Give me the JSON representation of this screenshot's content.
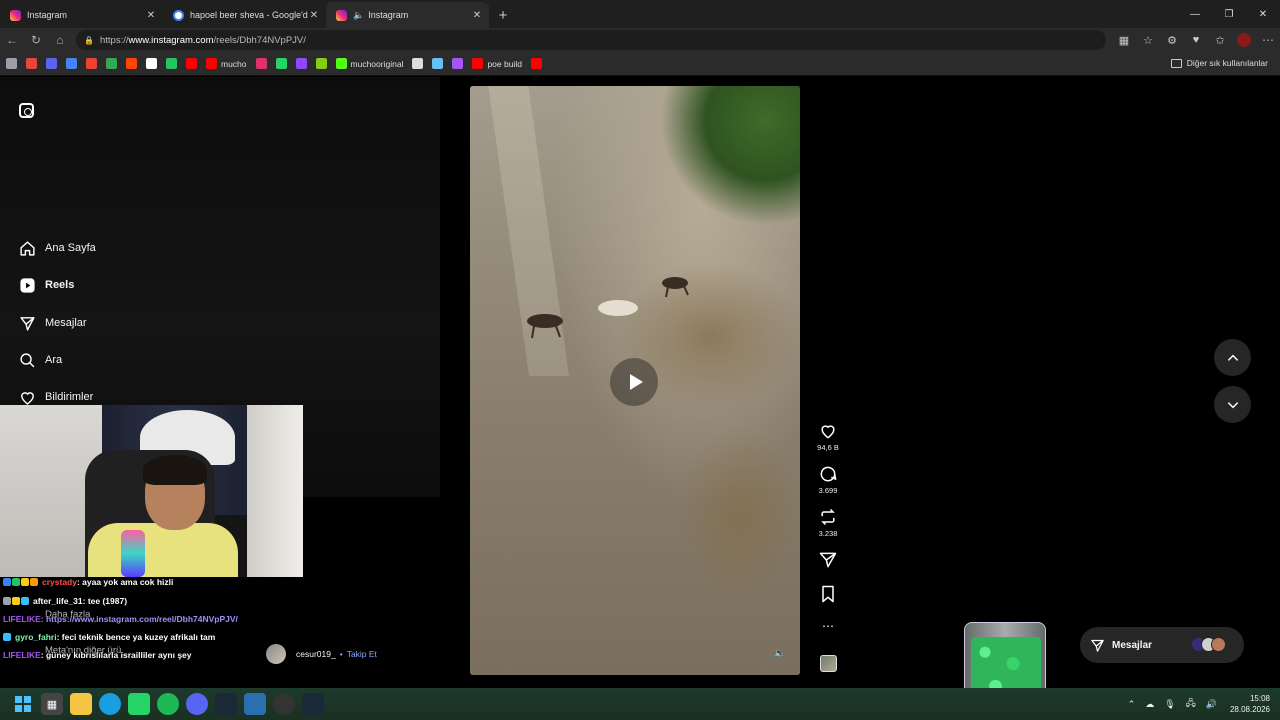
{
  "browser": {
    "tabs": [
      {
        "title": "Instagram",
        "favicon": "instagram-icon"
      },
      {
        "title": "hapoel beer sheva - Google'da Ara",
        "favicon": "google-icon"
      },
      {
        "title": "Instagram",
        "favicon": "instagram-icon",
        "active": true,
        "audio": true
      }
    ],
    "url": {
      "prefix": "https://",
      "host": "www.instagram.com",
      "path": "/reels/Dbh74NVpPJV/"
    },
    "bookmarks": [
      {
        "label": "",
        "icon": "link-icon",
        "color": "#9aa0a6"
      },
      {
        "label": "",
        "icon": "image-icon",
        "color": "#e8453c"
      },
      {
        "label": "",
        "icon": "discord-icon",
        "color": "#5865f2"
      },
      {
        "label": "",
        "icon": "docs-icon",
        "color": "#4285f4"
      },
      {
        "label": "",
        "icon": "gmail-icon",
        "color": "#ea4335"
      },
      {
        "label": "",
        "icon": "google-icon",
        "color": "#34a853"
      },
      {
        "label": "",
        "icon": "reddit-icon",
        "color": "#ff4500"
      },
      {
        "label": "",
        "icon": "x-icon",
        "color": "#ffffff"
      },
      {
        "label": "",
        "icon": "bar-icon",
        "color": "#22c55e"
      },
      {
        "label": "",
        "icon": "youtube-icon",
        "color": "#ff0000"
      },
      {
        "label": "mucho",
        "icon": "youtube-icon",
        "color": "#ff0000"
      },
      {
        "label": "",
        "icon": "instagram-icon",
        "color": "#e1306c"
      },
      {
        "label": "",
        "icon": "whatsapp-icon",
        "color": "#25d366"
      },
      {
        "label": "",
        "icon": "twitch-icon",
        "color": "#9146ff"
      },
      {
        "label": "",
        "icon": "star-icon",
        "color": "#84cc16"
      },
      {
        "label": "muchooriginal",
        "icon": "kick-icon",
        "color": "#53fc18"
      },
      {
        "label": "",
        "icon": "openai-icon",
        "color": "#dddddd"
      },
      {
        "label": "",
        "icon": "steam-icon",
        "color": "#66c0f4"
      },
      {
        "label": "",
        "icon": "pen-icon",
        "color": "#a855f7"
      },
      {
        "label": "poe build",
        "icon": "youtube-icon",
        "color": "#ff0000"
      },
      {
        "label": "",
        "icon": "youtube-icon",
        "color": "#ff0000"
      }
    ],
    "other_bookmarks": "Diğer sık kullanılanlar"
  },
  "instagram": {
    "nav": [
      {
        "label": "Ana Sayfa",
        "icon": "home-icon"
      },
      {
        "label": "Reels",
        "icon": "reels-icon",
        "active": true
      },
      {
        "label": "Mesajlar",
        "icon": "send-icon"
      },
      {
        "label": "Ara",
        "icon": "search-icon"
      },
      {
        "label": "Bildirimler",
        "icon": "heart-icon"
      }
    ],
    "more": "Daha fazla",
    "also_from_meta": "Meta'nın diğer ürü",
    "reel": {
      "likes": "94,6 B",
      "comments": "3.699",
      "reposts": "3.238",
      "author": "cesur019_",
      "follow": "Takip Et",
      "separator": "•"
    },
    "messages_pill": "Mesajlar"
  },
  "chat": [
    {
      "user": "crystady",
      "user_color": "#ff4d4d",
      "text": " : ayaa yok ama cok hizli",
      "badges": [
        "#3b82f6",
        "#22c55e",
        "#facc15",
        "#f59e0b"
      ]
    },
    {
      "user": "after_life_31",
      "user_color": "#ffffff",
      "text": " : tee (1987)",
      "badges": [
        "#9ca3af",
        "#facc15",
        "#38bdf8"
      ]
    },
    {
      "user": "LIFELIKE",
      "user_color": "#a855f7",
      "text": " : https://www.instagram.com/reel/Dbh74NVpPJV/",
      "text_color": "#a78bfa",
      "badges": []
    },
    {
      "user": "gyro_fahri",
      "user_color": "#86efac",
      "text": " : feci teknik bence ya kuzey afrikalı tam",
      "badges": [
        "#38bdf8"
      ]
    },
    {
      "user": "LIFELIKE",
      "user_color": "#a855f7",
      "text": " : güney kıbrıslılarla israilliler aynı şey",
      "badges": []
    }
  ],
  "taskbar": {
    "time": "15:08",
    "date": "28.08.2026"
  }
}
